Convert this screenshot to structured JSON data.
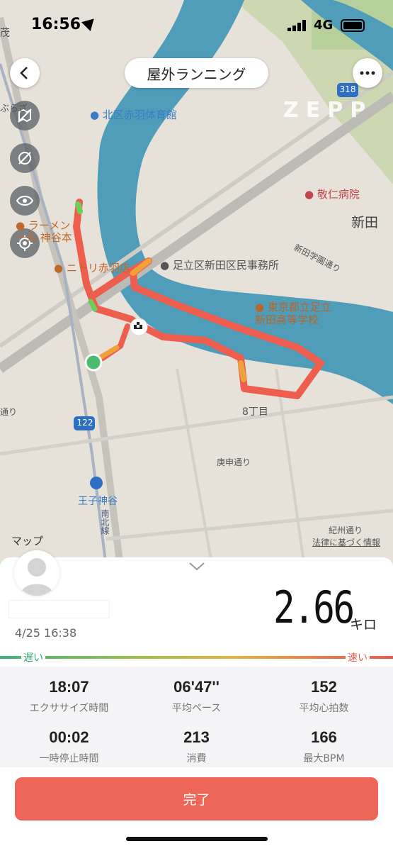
{
  "status": {
    "time": "16:56",
    "network": "4G"
  },
  "header": {
    "title": "屋外ランニング",
    "brand": "ZEPP"
  },
  "icons": {
    "back": "chevron-left-icon",
    "more": "more-dots-icon",
    "side": [
      "map-layer-off-icon",
      "location-off-icon",
      "eye-icon",
      "locate-icon"
    ]
  },
  "map": {
    "labels": {
      "gym": "北区赤羽体育館",
      "hospital": "敬仁病院",
      "shinden": "新田",
      "school_street": "新田学園通り",
      "office": "足立区新田区民事務所",
      "school": "東京都立足立新田高等学校",
      "ramen": "ラーメン 一丸 神谷本",
      "nitori": "ニトリ赤羽店",
      "chome": "8丁目",
      "koshin": "庚申通り",
      "oji": "王子神谷",
      "kishu": "紀州通り",
      "route122": "122",
      "route318": "318",
      "street_left": "通り",
      "nanboku": "南北線",
      "top_left": "茂",
      "top_left2": "ぶらざ"
    },
    "attribution": "マップ",
    "legal": "法律に基づく情報"
  },
  "summary": {
    "datetime": "4/25 16:38",
    "distance": "2.66",
    "distance_unit": "キロ",
    "speed_slow": "遅い",
    "speed_fast": "速い"
  },
  "stats": [
    {
      "value": "18:07",
      "label": "エクササイズ時間"
    },
    {
      "value": "06'47''",
      "label": "平均ペース"
    },
    {
      "value": "152",
      "label": "平均心拍数"
    },
    {
      "value": "00:02",
      "label": "一時停止時間"
    },
    {
      "value": "213",
      "label": "消費"
    },
    {
      "value": "166",
      "label": "最大BPM"
    }
  ],
  "footer": {
    "done_label": "完了"
  },
  "colors": {
    "route": "#ee5e4f",
    "route_fast": "#f0a23a",
    "river": "#4f9db8",
    "accent": "#ee6658"
  }
}
